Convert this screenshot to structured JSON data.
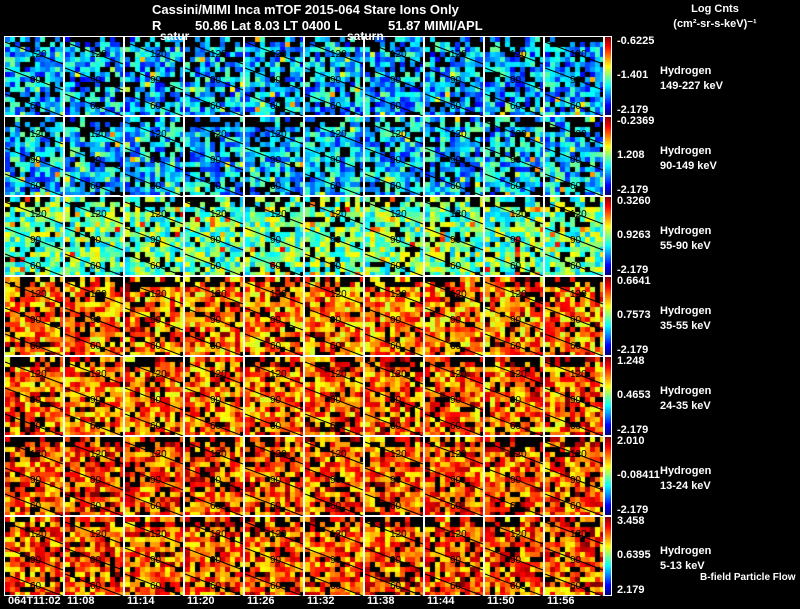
{
  "title": {
    "line1": "Cassini/MIMI Inca mTOF  2015-064   Stare   Ions Only",
    "r_label": "R",
    "line2_mid": "50.86 Lat 8.03 LT 0400 L",
    "line2_right": "51.87  MIMI/APL",
    "satur_label_1": "satur",
    "satur_label_2": "saturn"
  },
  "units": {
    "line1": "Log Cnts",
    "line2": "(cm²-sr-s-keV)⁻¹"
  },
  "footer": "B-field Particle Flow",
  "chart_data": {
    "type": "heatmap",
    "time_labels": [
      "064T11:02",
      "11:08",
      "11:14",
      "11:20",
      "11:26",
      "11:32",
      "11:38",
      "11:44",
      "11:50",
      "11:56"
    ],
    "contour_labels": [
      "120",
      "90",
      "60"
    ],
    "colormap": "jet",
    "rows": [
      {
        "species": "Hydrogen",
        "energy": "149-227 keV",
        "cbar_max": "-0.6225",
        "cbar_mid": "-1.401",
        "cbar_min": "-2.179",
        "level": 0.3
      },
      {
        "species": "Hydrogen",
        "energy": "90-149 keV",
        "cbar_max": "-0.2369",
        "cbar_mid": "1.208",
        "cbar_min": "-2.179",
        "level": 0.32
      },
      {
        "species": "Hydrogen",
        "energy": "55-90 keV",
        "cbar_max": "0.3260",
        "cbar_mid": "0.9263",
        "cbar_min": "-2.179",
        "level": 0.48
      },
      {
        "species": "Hydrogen",
        "energy": "35-55 keV",
        "cbar_max": "0.6641",
        "cbar_mid": "0.7573",
        "cbar_min": "-2.179",
        "level": 0.74
      },
      {
        "species": "Hydrogen",
        "energy": "24-35 keV",
        "cbar_max": "1.248",
        "cbar_mid": "0.4653",
        "cbar_min": "-2.179",
        "level": 0.76
      },
      {
        "species": "Hydrogen",
        "energy": "13-24 keV",
        "cbar_max": "2.010",
        "cbar_mid": "-0.08411",
        "cbar_min": "-2.179",
        "level": 0.78
      },
      {
        "species": "Hydrogen",
        "energy": "5-13 keV",
        "cbar_max": "3.458",
        "cbar_mid": "0.6395",
        "cbar_min": "2.179",
        "level": 0.78
      }
    ]
  }
}
